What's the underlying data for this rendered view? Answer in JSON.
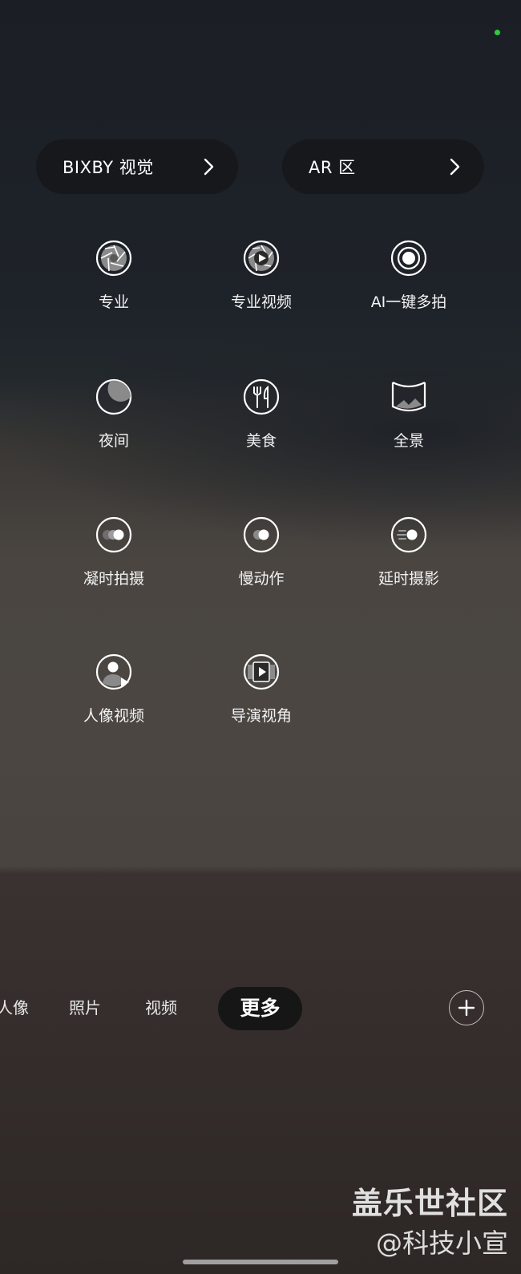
{
  "top_buttons": {
    "bixby": "BIXBY 视觉",
    "ar": "AR 区"
  },
  "modes": [
    {
      "label": "专业",
      "icon": "aperture-icon"
    },
    {
      "label": "专业视频",
      "icon": "aperture-video-icon"
    },
    {
      "label": "AI一键多拍",
      "icon": "single-take-icon"
    },
    {
      "label": "夜间",
      "icon": "moon-icon"
    },
    {
      "label": "美食",
      "icon": "fork-knife-icon"
    },
    {
      "label": "全景",
      "icon": "panorama-icon"
    },
    {
      "label": "凝时拍摄",
      "icon": "hyperlapse-icon"
    },
    {
      "label": "慢动作",
      "icon": "slow-motion-icon"
    },
    {
      "label": "延时摄影",
      "icon": "time-lapse-icon"
    },
    {
      "label": "人像视频",
      "icon": "portrait-video-icon"
    },
    {
      "label": "导演视角",
      "icon": "directors-view-icon"
    }
  ],
  "bottom_tabs": {
    "portrait": "人像",
    "photo": "照片",
    "video": "视频",
    "more": "更多"
  },
  "watermark": {
    "line1": "盖乐世社区",
    "line2": "@科技小宣"
  },
  "colors": {
    "status_dot": "#2ecc40"
  }
}
